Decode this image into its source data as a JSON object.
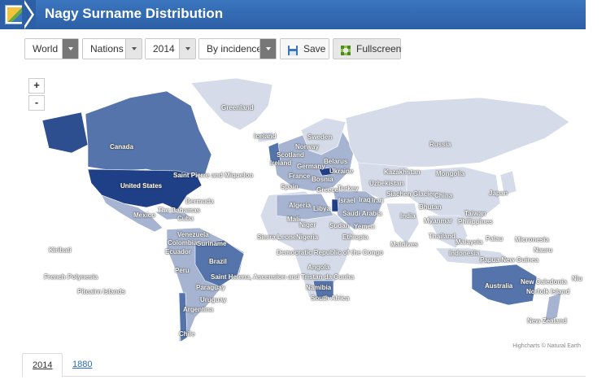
{
  "header": {
    "title": "Nagy Surname Distribution"
  },
  "toolbar": {
    "region": "World",
    "level": "Nations",
    "year": "2014",
    "mode": "By incidence",
    "save_label": "Save",
    "fullscreen_label": "Fullscreen"
  },
  "map": {
    "zoom_in": "+",
    "zoom_out": "-",
    "credit": "Highcharts © Natural Earth",
    "labels": {
      "greenland": "Greenland",
      "iceland": "Iceland",
      "sweden": "Sweden",
      "norway": "Norway",
      "scotland": "Scotland",
      "russia": "Russia",
      "canada": "Canada",
      "belarus": "Belarus",
      "germany": "Germany",
      "ireland": "Ireland",
      "ukraine": "Ukraine",
      "kazakhstan": "Kazakhstan",
      "mongolia": "Mongolia",
      "spm": "Saint Pierre and Miquelon",
      "france": "France",
      "bosnia": "Bosnia",
      "uzbekistan": "Uzbekistan",
      "united_states": "United States",
      "spain": "Spain",
      "greece": "Greece",
      "turkey": "Turkey",
      "siachen": "Siachen Glacier",
      "china": "China",
      "japan": "Japan",
      "israel": "Israel",
      "iraq": "Iraq",
      "iran": "Iran",
      "bermuda": "Bermuda",
      "algeria": "Algeria",
      "libya": "Libya",
      "bhutan": "Bhutan",
      "mexico": "Mexico",
      "bahamas": "The Bahamas",
      "saudi_arabia": "Saudi Arabia",
      "india": "India",
      "taiwan": "Taiwan",
      "cuba": "Cuba",
      "mali": "Mali",
      "yemen": "Yemen",
      "sudan": "Sudan",
      "myanmar": "Myanmar",
      "philippines": "Philippines",
      "niger": "Niger",
      "venezuela": "Venezuela",
      "sierra_leone": "Sierra Leone",
      "nigeria": "Nigeria",
      "ethiopia": "Ethiopia",
      "thailand": "Thailand",
      "palau": "Palau",
      "micronesia": "Micronesia",
      "colombia": "Colombia",
      "suriname": "Suriname",
      "kiribati": "Kiribati",
      "maldives": "Maldives",
      "malaysia": "Malaysia",
      "nauru": "Nauru",
      "ecuador": "Ecuador",
      "drc": "Democratic Republic of the Congo",
      "indonesia": "Indonesia",
      "png": "Papua New Guinea",
      "brazil": "Brazil",
      "peru": "Peru",
      "angola": "Angola",
      "french_polynesia": "French Polynesia",
      "st_helena": "Saint Helena, Ascension and Tristan da Cunha",
      "new_caledonia": "New Caledonia",
      "niue": "Niu",
      "paraguay": "Paraguay",
      "namibia": "Namibia",
      "australia": "Australia",
      "norfolk": "Norfolk Island",
      "pitcairn": "Pitcairn Islands",
      "uruguay": "Uruguay",
      "south_africa": "South Africa",
      "argentina": "Argentina",
      "new_zealand": "New Zealand",
      "chile": "Chile"
    }
  },
  "tabs": [
    {
      "label": "2014"
    },
    {
      "label": "1880"
    }
  ],
  "colors": {
    "header": "#2c5fa6",
    "dark": "#1f3f86",
    "mid": "#5474ab",
    "light": "#a6b4d1",
    "pale": "#d5dbe8",
    "none": "#f2f2f2"
  }
}
